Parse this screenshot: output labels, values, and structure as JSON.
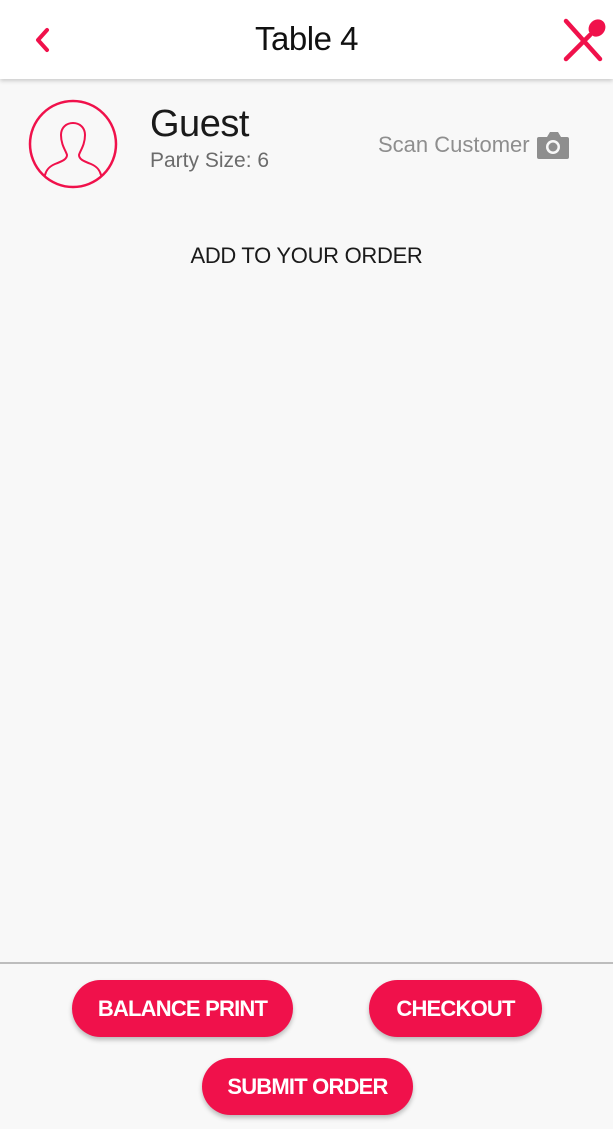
{
  "header": {
    "title": "Table 4",
    "back_icon": "chevron-left-icon",
    "right_icon": "utensils-crossed-icon"
  },
  "customer": {
    "name": "Guest",
    "party_size": "Party Size: 6",
    "avatar_icon": "user-silhouette-icon",
    "scan_label": "Scan Customer",
    "scan_icon": "camera-icon"
  },
  "order": {
    "heading": "ADD TO YOUR ORDER"
  },
  "footer": {
    "balance_print_label": "BALANCE PRINT",
    "checkout_label": "CHECKOUT",
    "submit_order_label": "SUBMIT ORDER"
  },
  "colors": {
    "accent": "#f0114b",
    "background": "#f8f8f8",
    "header_bg": "#ffffff",
    "muted_text": "#8e8e8e"
  }
}
